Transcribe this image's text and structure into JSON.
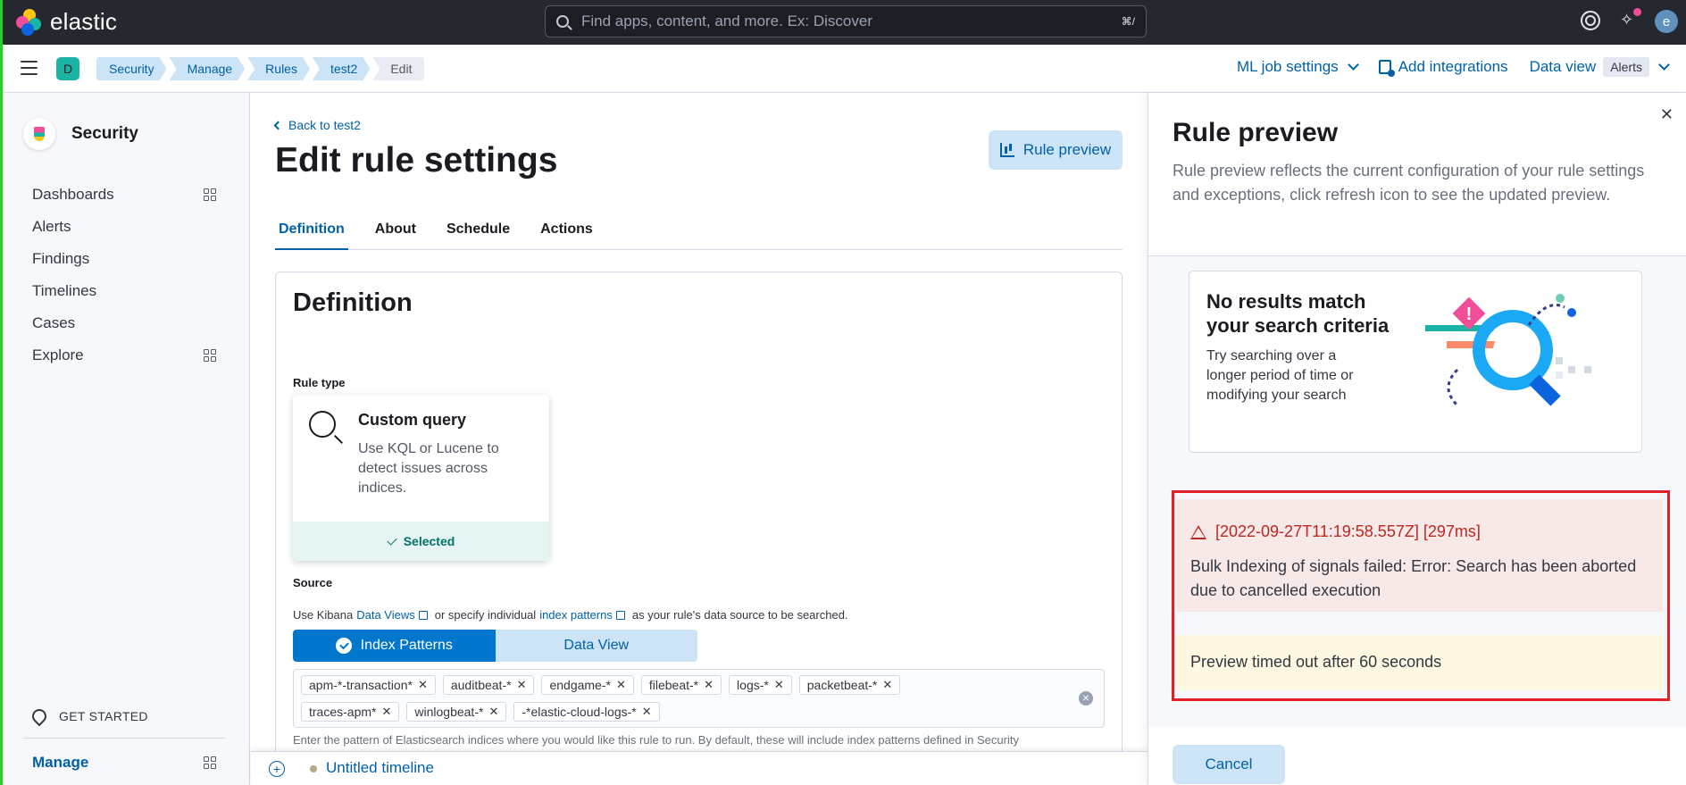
{
  "header": {
    "brand": "elastic",
    "search_placeholder": "Find apps, content, and more. Ex: Discover",
    "search_shortcut": "⌘/",
    "avatar_initial": "e"
  },
  "subbar": {
    "space_initial": "D",
    "breadcrumbs": [
      "Security",
      "Manage",
      "Rules",
      "test2",
      "Edit"
    ],
    "ml_job_settings": "ML job settings",
    "add_integrations": "Add integrations",
    "data_view_label": "Data view",
    "data_view_value": "Alerts"
  },
  "sidebar": {
    "title": "Security",
    "items": [
      {
        "label": "Dashboards"
      },
      {
        "label": "Alerts"
      },
      {
        "label": "Findings"
      },
      {
        "label": "Timelines"
      },
      {
        "label": "Cases"
      },
      {
        "label": "Explore"
      }
    ],
    "get_started": "GET STARTED",
    "manage": "Manage"
  },
  "main": {
    "back_link": "Back to test2",
    "title": "Edit rule settings",
    "rule_preview_button": "Rule preview",
    "tabs": [
      "Definition",
      "About",
      "Schedule",
      "Actions"
    ],
    "section_title": "Definition",
    "rule_type_label": "Rule type",
    "rule_type": {
      "name": "Custom query",
      "description": "Use KQL or Lucene to detect issues across indices.",
      "selected": "Selected"
    },
    "source_label": "Source",
    "source_help": {
      "prefix": "Use Kibana",
      "data_views_link": "Data Views",
      "middle": "or specify individual",
      "index_patterns_link": "index patterns",
      "suffix": "as your rule's data source to be searched."
    },
    "toggle": {
      "index_patterns": "Index Patterns",
      "data_view": "Data View"
    },
    "index_patterns": [
      "apm-*-transaction*",
      "auditbeat-*",
      "endgame-*",
      "filebeat-*",
      "logs-*",
      "packetbeat-*",
      "traces-apm*",
      "winlogbeat-*",
      "-*elastic-cloud-logs-*"
    ],
    "index_help": "Enter the pattern of Elasticsearch indices where you would like this rule to run. By default, these will include index patterns defined in Security"
  },
  "timeline": {
    "name": "Untitled timeline"
  },
  "flyout": {
    "title": "Rule preview",
    "description": "Rule preview reflects the current configuration of your rule settings and exceptions, click refresh icon to see the updated preview.",
    "empty_title": "No results match your search criteria",
    "empty_desc": "Try searching over a longer period of time or modifying your search",
    "error_heading": "[2022-09-27T11:19:58.557Z] [297ms]",
    "error_message": "Bulk Indexing of signals failed: Error: Search has been aborted due to cancelled execution",
    "warning_message": "Preview timed out after 60 seconds",
    "cancel_button": "Cancel"
  }
}
